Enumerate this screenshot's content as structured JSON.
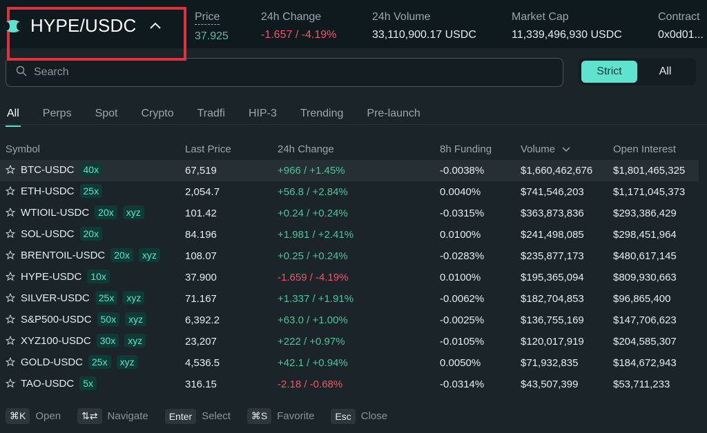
{
  "header": {
    "pair": "HYPE/USDC",
    "stats": [
      {
        "label": "Price",
        "value": "37.925"
      },
      {
        "label": "24h Change",
        "value": "-1.657 / -4.19%"
      },
      {
        "label": "24h Volume",
        "value": "33,110,900.17 USDC"
      },
      {
        "label": "Market Cap",
        "value": "11,339,496,930 USDC"
      },
      {
        "label": "Contract",
        "value": "0x0d01..."
      }
    ]
  },
  "search": {
    "placeholder": "Search",
    "value": ""
  },
  "toggle": {
    "strict": "Strict",
    "all": "All"
  },
  "tabs": [
    "All",
    "Perps",
    "Spot",
    "Crypto",
    "Tradfi",
    "HIP-3",
    "Trending",
    "Pre-launch"
  ],
  "columns": [
    "Symbol",
    "Last Price",
    "24h Change",
    "8h Funding",
    "Volume",
    "Open Interest"
  ],
  "rows": [
    {
      "symbol": "BTC-USDC",
      "lev": "40x",
      "tag": "",
      "price": "67,519",
      "change": "+966 / +1.45%",
      "funding": "-0.0038%",
      "volume": "$1,660,462,676",
      "oi": "$1,801,465,325"
    },
    {
      "symbol": "ETH-USDC",
      "lev": "25x",
      "tag": "",
      "price": "2,054.7",
      "change": "+56.8 / +2.84%",
      "funding": "0.0040%",
      "volume": "$741,546,203",
      "oi": "$1,171,045,373"
    },
    {
      "symbol": "WTIOIL-USDC",
      "lev": "20x",
      "tag": "xyz",
      "price": "101.42",
      "change": "+0.24 / +0.24%",
      "funding": "-0.0315%",
      "volume": "$363,873,836",
      "oi": "$293,386,429"
    },
    {
      "symbol": "SOL-USDC",
      "lev": "20x",
      "tag": "",
      "price": "84.196",
      "change": "+1.981 / +2.41%",
      "funding": "0.0100%",
      "volume": "$241,498,085",
      "oi": "$298,451,964"
    },
    {
      "symbol": "BRENTOIL-USDC",
      "lev": "20x",
      "tag": "xyz",
      "price": "108.07",
      "change": "+0.25 / +0.24%",
      "funding": "-0.0283%",
      "volume": "$235,877,173",
      "oi": "$480,617,145"
    },
    {
      "symbol": "HYPE-USDC",
      "lev": "10x",
      "tag": "",
      "price": "37.900",
      "change": "-1.659 / -4.19%",
      "funding": "0.0100%",
      "volume": "$195,365,094",
      "oi": "$809,930,663"
    },
    {
      "symbol": "SILVER-USDC",
      "lev": "25x",
      "tag": "xyz",
      "price": "71.167",
      "change": "+1.337 / +1.91%",
      "funding": "-0.0062%",
      "volume": "$182,704,853",
      "oi": "$96,865,400"
    },
    {
      "symbol": "S&P500-USDC",
      "lev": "50x",
      "tag": "xyz",
      "price": "6,392.2",
      "change": "+63.0 / +1.00%",
      "funding": "-0.0025%",
      "volume": "$136,755,169",
      "oi": "$147,706,623"
    },
    {
      "symbol": "XYZ100-USDC",
      "lev": "30x",
      "tag": "xyz",
      "price": "23,207",
      "change": "+222 / +0.97%",
      "funding": "-0.0105%",
      "volume": "$120,017,919",
      "oi": "$204,585,307"
    },
    {
      "symbol": "GOLD-USDC",
      "lev": "25x",
      "tag": "xyz",
      "price": "4,536.5",
      "change": "+42.1 / +0.94%",
      "funding": "0.0050%",
      "volume": "$71,932,835",
      "oi": "$184,672,943"
    },
    {
      "symbol": "TAO-USDC",
      "lev": "5x",
      "tag": "",
      "price": "316.15",
      "change": "-2.18 / -0.68%",
      "funding": "-0.0314%",
      "volume": "$43,507,399",
      "oi": "$53,711,233"
    }
  ],
  "footer": [
    {
      "key": "⌘K",
      "label": "Open"
    },
    {
      "key": "⇅⇄",
      "label": "Navigate"
    },
    {
      "key": "Enter",
      "label": "Select"
    },
    {
      "key": "⌘S",
      "label": "Favorite"
    },
    {
      "key": "Esc",
      "label": "Close"
    }
  ],
  "colors": {
    "accent": "#5fe3cf",
    "positive": "#4cc59a",
    "negative": "#ee5766",
    "highlight_box": "#e0323c"
  }
}
